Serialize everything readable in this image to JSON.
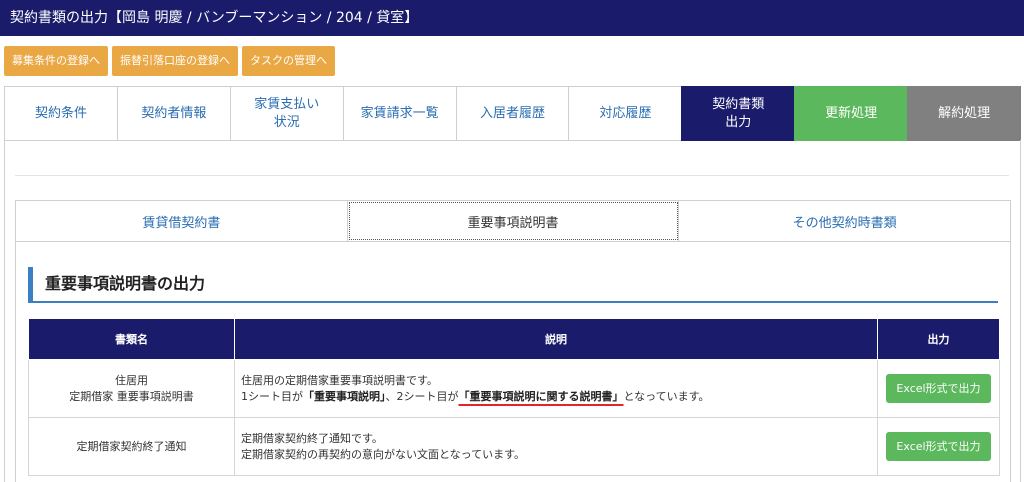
{
  "header": {
    "title": "契約書類の出力【岡島 明慶 / バンブーマンション / 204 / 貸室】"
  },
  "quick_links": [
    {
      "label": "募集条件の登録へ"
    },
    {
      "label": "振替引落口座の登録へ"
    },
    {
      "label": "タスクの管理へ"
    }
  ],
  "main_tabs": [
    {
      "label": "契約条件"
    },
    {
      "label": "契約者情報"
    },
    {
      "label": "家賃支払い\n状況"
    },
    {
      "label": "家賃請求一覧"
    },
    {
      "label": "入居者履歴"
    },
    {
      "label": "対応履歴"
    },
    {
      "label": "契約書類\n出力"
    },
    {
      "label": "更新処理"
    },
    {
      "label": "解約処理"
    }
  ],
  "sub_tabs": [
    {
      "label": "賃貸借契約書"
    },
    {
      "label": "重要事項説明書"
    },
    {
      "label": "その他契約時書類"
    }
  ],
  "section": {
    "title": "重要事項説明書の出力"
  },
  "table": {
    "headers": [
      "書類名",
      "説明",
      "出力"
    ],
    "rows": [
      {
        "name_line1": "住居用",
        "name_line2": "定期借家 重要事項説明書",
        "desc_line1": "住居用の定期借家重要事項説明書です。",
        "desc_line2_part1": "1シート目が",
        "desc_line2_quote1": "「重要事項説明」",
        "desc_line2_part2": "、2シート目が",
        "desc_line2_quote2": "「重要事項説明に関する説明書」",
        "desc_line2_part3": "となっています。",
        "button": "Excel形式で出力"
      },
      {
        "name_line1": "定期借家契約終了通知",
        "desc_line1": "定期借家契約終了通知です。",
        "desc_line2": "定期借家契約の再契約の意向がない文面となっています。",
        "button": "Excel形式で出力"
      }
    ]
  },
  "colors": {
    "navy": "#1b1b6b",
    "orange": "#eaa845",
    "green": "#5cb85c",
    "gray": "#808080",
    "link_blue": "#2a6db2",
    "accent_blue": "#3a7fc1",
    "underline_red": "#e0262c"
  }
}
